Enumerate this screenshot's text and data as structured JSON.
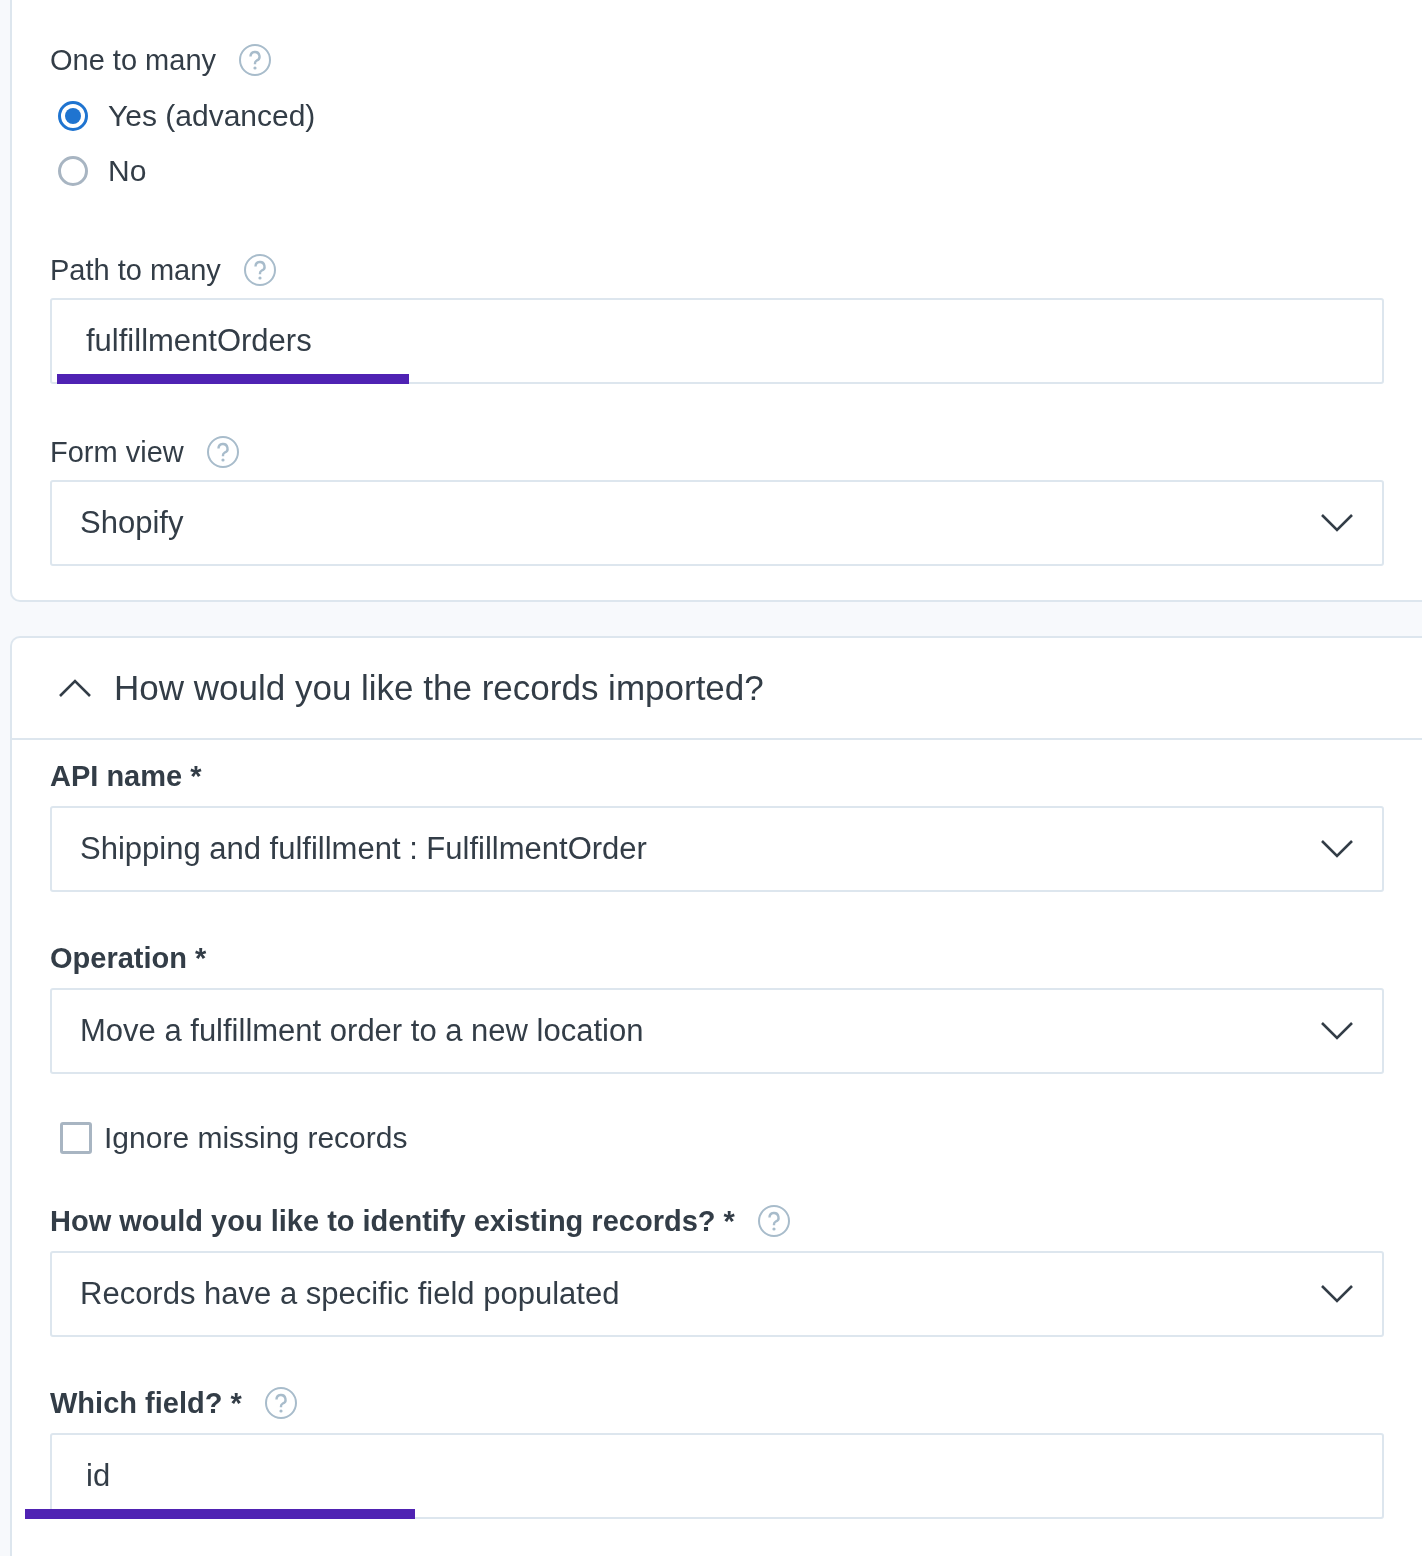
{
  "settings_card": {
    "fields": [
      {
        "kind": "radio",
        "label": "One to many",
        "help": true,
        "options": [
          {
            "label": "Yes (advanced)",
            "selected": true
          },
          {
            "label": "No",
            "selected": false
          }
        ]
      },
      {
        "kind": "text",
        "label": "Path to many",
        "help": true,
        "value": "fulfillmentOrders"
      },
      {
        "kind": "select",
        "label": "Form view",
        "help": true,
        "value": "Shopify"
      }
    ]
  },
  "import_section": {
    "title": "How would you like the records imported?",
    "expanded": true,
    "fields": [
      {
        "kind": "select",
        "label": "API name *",
        "help": false,
        "value": "Shipping and fulfillment : FulfillmentOrder"
      },
      {
        "kind": "select",
        "label": "Operation *",
        "help": false,
        "value": "Move a fulfillment order to a new location"
      },
      {
        "kind": "checkbox",
        "label": "Ignore missing records",
        "checked": false
      },
      {
        "kind": "select",
        "label": "How would you like to identify existing records? *",
        "help": true,
        "value": "Records have a specific field populated"
      },
      {
        "kind": "text",
        "label": "Which field? *",
        "help": true,
        "value": "id"
      }
    ]
  }
}
